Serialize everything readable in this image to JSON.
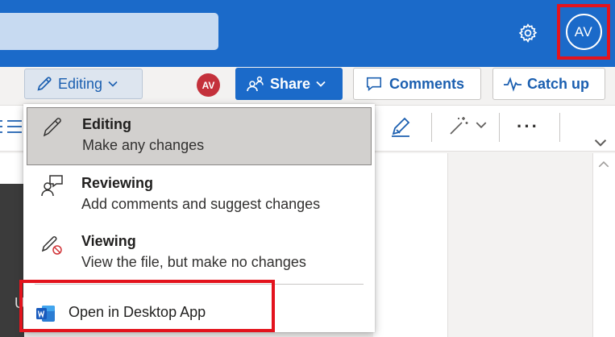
{
  "header": {
    "avatar_initials": "AV",
    "accent_color": "#1b6ac9",
    "highlight_color": "#e3131d"
  },
  "command_bar": {
    "mode_label": "Editing",
    "collaborator_initials": "AV",
    "share_label": "Share",
    "comments_label": "Comments",
    "catchup_label": "Catch up"
  },
  "ribbon": {
    "more_label": "···"
  },
  "mode_menu": {
    "items": [
      {
        "title": "Editing",
        "description": "Make any changes",
        "icon": "pencil-icon",
        "selected": true
      },
      {
        "title": "Reviewing",
        "description": "Add comments and suggest changes",
        "icon": "reviewing-icon",
        "selected": false
      },
      {
        "title": "Viewing",
        "description": "View the file, but make no changes",
        "icon": "viewing-icon",
        "selected": false
      }
    ],
    "open_desktop_label": "Open in Desktop App",
    "open_desktop_icon": "word-icon"
  },
  "document": {
    "partial_letter": "U"
  }
}
